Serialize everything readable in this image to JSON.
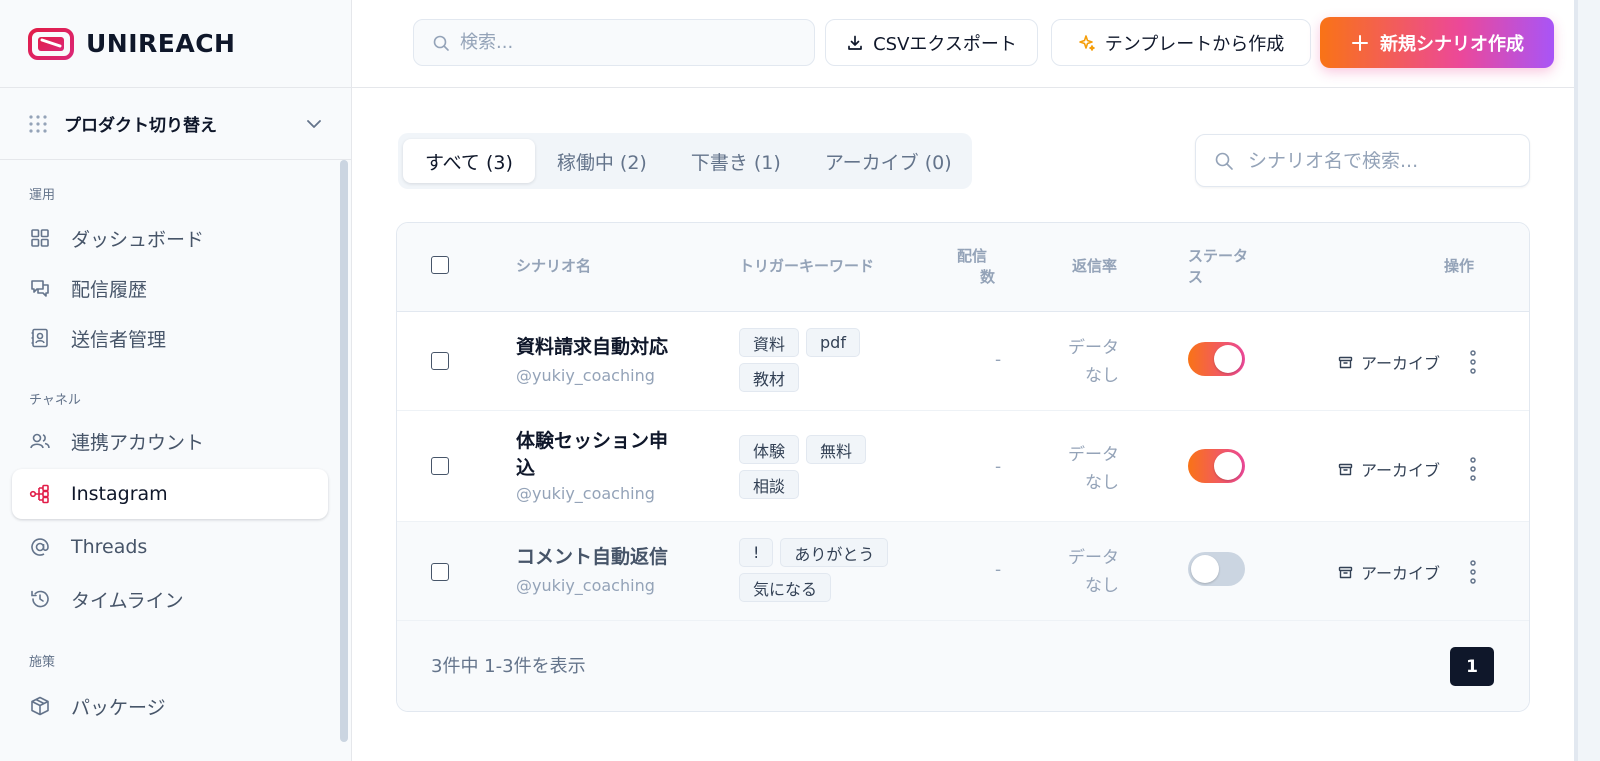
{
  "brand": {
    "name": "UNIREACH"
  },
  "product_switch": {
    "label": "プロダクト切り替え"
  },
  "sidebar": {
    "sections": [
      {
        "title": "運用",
        "items": [
          {
            "label": "ダッシュボード",
            "icon": "grid-icon"
          },
          {
            "label": "配信履歴",
            "icon": "chat-bubbles-icon"
          },
          {
            "label": "送信者管理",
            "icon": "contact-card-icon"
          }
        ]
      },
      {
        "title": "チャネル",
        "items": [
          {
            "label": "連携アカウント",
            "icon": "users-icon"
          },
          {
            "label": "Instagram",
            "icon": "workflow-icon",
            "active": true
          },
          {
            "label": "Threads",
            "icon": "at-sign-icon"
          },
          {
            "label": "タイムライン",
            "icon": "history-icon"
          }
        ]
      },
      {
        "title": "施策",
        "items": [
          {
            "label": "パッケージ",
            "icon": "package-icon"
          }
        ]
      }
    ]
  },
  "header": {
    "search_placeholder": "検索...",
    "csv_export_label": "CSVエクスポート",
    "template_label": "テンプレートから作成",
    "new_scenario_label": "新規シナリオ作成"
  },
  "tabs": [
    {
      "label": "すべて (3)",
      "active": true
    },
    {
      "label": "稼働中 (2)"
    },
    {
      "label": "下書き (1)"
    },
    {
      "label": "アーカイブ (0)"
    }
  ],
  "scenario_search_placeholder": "シナリオ名で検索...",
  "table": {
    "columns": {
      "name": "シナリオ名",
      "trigger": "トリガーキーワード",
      "sent_line1": "配信",
      "sent_line2": "数",
      "reply_rate": "返信率",
      "status_line1": "ステータ",
      "status_line2": "ス",
      "actions": "操作"
    },
    "rows": [
      {
        "name": "資料請求自動対応",
        "handle": "@yukiy_coaching",
        "tags": [
          "資料",
          "pdf",
          "教材"
        ],
        "sent": "-",
        "reply_rate_line1": "データ",
        "reply_rate_line2": "なし",
        "status": "on",
        "archive_label": "アーカイブ"
      },
      {
        "name": "体験セッション申込",
        "handle": "@yukiy_coaching",
        "tags": [
          "体験",
          "無料",
          "相談"
        ],
        "sent": "-",
        "reply_rate_line1": "データ",
        "reply_rate_line2": "なし",
        "status": "on",
        "archive_label": "アーカイブ"
      },
      {
        "name": "コメント自動返信",
        "handle": "@yukiy_coaching",
        "tags": [
          "!",
          "ありがとう",
          "気になる"
        ],
        "sent": "-",
        "reply_rate_line1": "データ",
        "reply_rate_line2": "なし",
        "status": "off",
        "archive_label": "アーカイブ"
      }
    ],
    "footer": {
      "summary": "3件中 1-3件を表示",
      "current_page": "1"
    }
  },
  "colors": {
    "brand": "#e11d48",
    "gradient_start": "#f97316",
    "gradient_mid": "#ec4899",
    "gradient_end": "#a855f7",
    "page_active": "#0f172a"
  }
}
